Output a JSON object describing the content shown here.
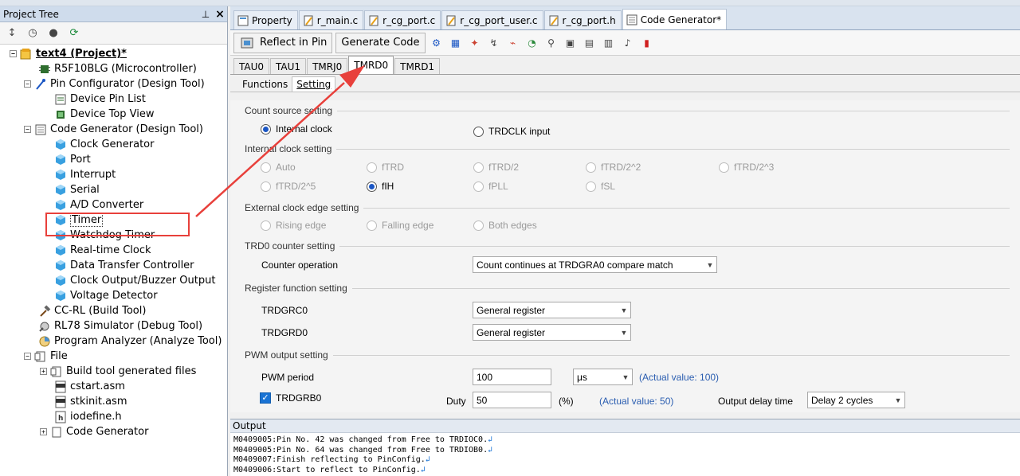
{
  "project_tree": {
    "title": "Project Tree",
    "pin_glyph": "ᵖ",
    "close_glyph": "×",
    "nodes": [
      "text4 (Project)*",
      "R5F10BLG (Microcontroller)",
      "Pin Configurator (Design Tool)",
      "Device Pin List",
      "Device Top View",
      "Code Generator (Design Tool)",
      "Clock Generator",
      "Port",
      "Interrupt",
      "Serial",
      "A/D Converter",
      "Timer",
      "Watchdog Timer",
      "Real-time Clock",
      "Data Transfer Controller",
      "Clock Output/Buzzer Output",
      "Voltage Detector",
      "CC-RL (Build Tool)",
      "RL78 Simulator (Debug Tool)",
      "Program Analyzer (Analyze Tool)",
      "File",
      "Build tool generated files",
      "cstart.asm",
      "stkinit.asm",
      "iodefine.h",
      "Code Generator"
    ]
  },
  "doc_tabs": [
    "Property",
    "r_main.c",
    "r_cg_port.c",
    "r_cg_port_user.c",
    "r_cg_port.h",
    "Code Generator*"
  ],
  "toolbar": {
    "reflect_in_pin": "Reflect in Pin",
    "generate_code": "Generate Code"
  },
  "timer_tabs": [
    "TAU0",
    "TAU1",
    "TMRJ0",
    "TMRD0",
    "TMRD1"
  ],
  "func_tabs": [
    "Functions",
    "Setting"
  ],
  "form": {
    "count_source_setting": "Count source setting",
    "internal_clock": "Internal clock",
    "trdclk_input": "TRDCLK input",
    "internal_clock_setting": "Internal clock setting",
    "clk_options_row1": [
      "Auto",
      "fTRD",
      "fTRD/2",
      "fTRD/2^2",
      "fTRD/2^3"
    ],
    "clk_options_row2": [
      "fTRD/2^5",
      "fIH",
      "fPLL",
      "fSL"
    ],
    "external_clock_edge_setting": "External clock edge setting",
    "edge_options": [
      "Rising edge",
      "Falling edge",
      "Both edges"
    ],
    "trd0_counter_setting": "TRD0 counter setting",
    "counter_operation_label": "Counter operation",
    "counter_operation_value": "Count continues at TRDGRA0 compare match",
    "register_function_setting": "Register function setting",
    "trdgrc0_label": "TRDGRC0",
    "trdgrc0_value": "General register",
    "trdgrd0_label": "TRDGRD0",
    "trdgrd0_value": "General register",
    "pwm_output_setting": "PWM output setting",
    "pwm_period_label": "PWM period",
    "pwm_period_value": "100",
    "pwm_period_unit": "μs",
    "pwm_period_actual": "(Actual value: 100)",
    "trdgrb0_label": "TRDGRB0",
    "duty_label": "Duty",
    "duty_value": "50",
    "duty_unit": "(%)",
    "duty_actual": "(Actual value: 50)",
    "output_delay_label": "Output delay time",
    "output_delay_value": "Delay 2 cycles"
  },
  "output": {
    "title": "Output",
    "lines": [
      "M0409005:Pin No. 42 was changed from Free to TRDIOC0.",
      "M0409005:Pin No. 64 was changed from Free to TRDIOB0.",
      "M0409007:Finish reflecting to PinConfig.",
      "M0409006:Start to reflect to PinConfig."
    ]
  },
  "colors": {
    "highlight": "#e8403b",
    "accent": "#1a56c4"
  }
}
